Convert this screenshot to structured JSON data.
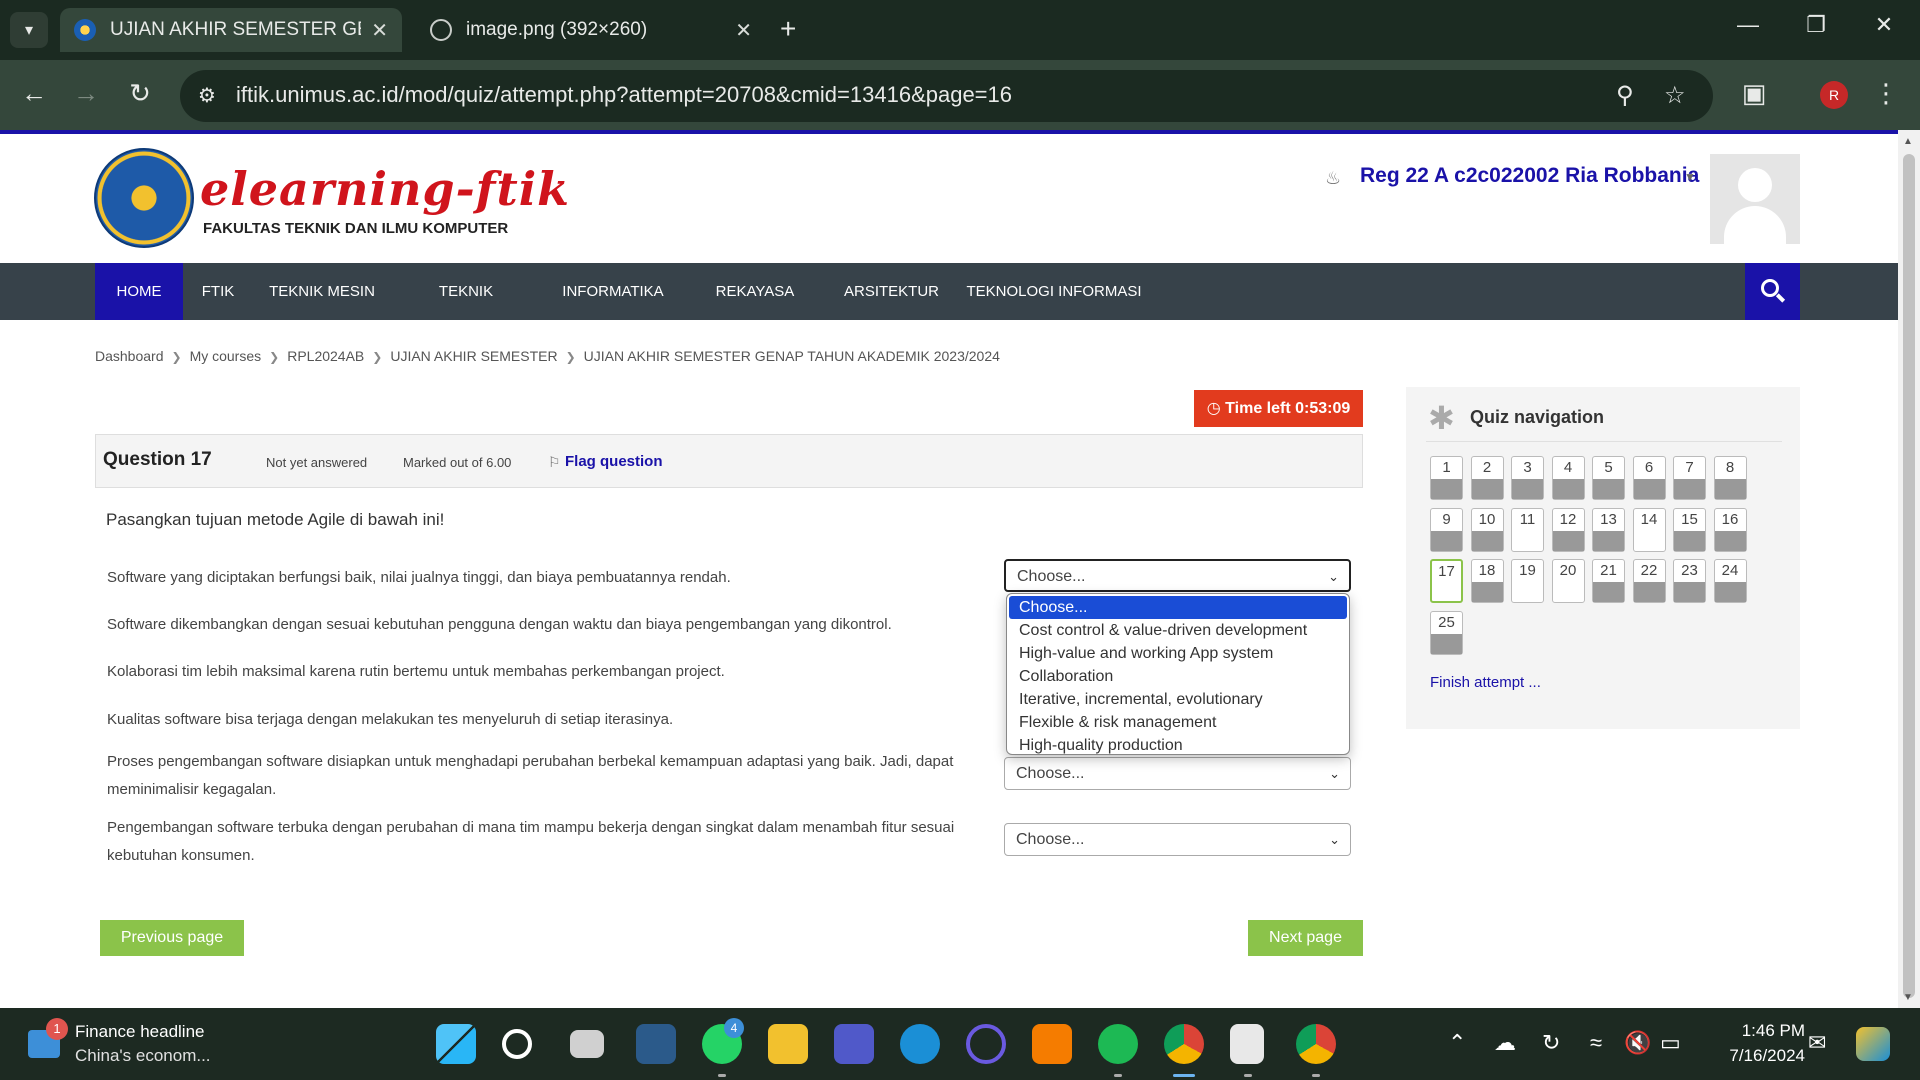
{
  "browser": {
    "tabs": [
      {
        "title": "UJIAN AKHIR SEMESTER GENAP",
        "active": true
      },
      {
        "title": "image.png (392×260)",
        "active": false
      }
    ],
    "url": "iftik.unimus.ac.id/mod/quiz/attempt.php?attempt=20708&cmid=13416&page=16",
    "profile_initial": "R"
  },
  "site": {
    "logo_title": "elearning-ftik",
    "logo_subtitle": "FAKULTAS TEKNIK DAN ILMU KOMPUTER",
    "user_name": "Reg 22 A c2c022002 Ria Robbania"
  },
  "nav": {
    "items": [
      "HOME",
      "FTIK",
      "TEKNIK MESIN",
      "TEKNIK ELEKTRO",
      "INFORMATIKA",
      "REKAYASA SIPIL",
      "ARSITEKTUR",
      "TEKNOLOGI INFORMASI"
    ],
    "active": "HOME"
  },
  "breadcrumb": [
    "Dashboard",
    "My courses",
    "RPL2024AB",
    "UJIAN AKHIR SEMESTER",
    "UJIAN AKHIR SEMESTER GENAP TAHUN AKADEMIK 2023/2024"
  ],
  "timer": "Time left 0:53:09",
  "question": {
    "number_label": "Question 17",
    "state": "Not yet answered",
    "grade": "Marked out of 6.00",
    "flag_label": "Flag question",
    "text": "Pasangkan tujuan metode Agile di bawah ini!",
    "rows": [
      {
        "text": "Software yang diciptakan berfungsi baik, nilai jualnya tinggi, dan biaya pembuatannya rendah.",
        "value": "Choose..."
      },
      {
        "text": "Software dikembangkan dengan sesuai kebutuhan pengguna dengan waktu dan biaya pengembangan yang dikontrol.",
        "value": "Choose..."
      },
      {
        "text": "Kolaborasi tim lebih maksimal karena rutin bertemu untuk membahas perkembangan project.",
        "value": "Choose..."
      },
      {
        "text": "Kualitas software bisa terjaga dengan melakukan tes menyeluruh di setiap iterasinya.",
        "value": "Choose..."
      },
      {
        "text": "Proses pengembangan software disiapkan untuk menghadapi perubahan berbekal kemampuan adaptasi yang baik. Jadi, dapat meminimalisir kegagalan.",
        "value": "Choose..."
      },
      {
        "text": "Pengembangan software terbuka dengan perubahan di mana tim mampu bekerja dengan singkat dalam menambah fitur sesuai kebutuhan konsumen.",
        "value": "Choose..."
      }
    ],
    "dropdown_options": [
      "Choose...",
      "Cost control & value-driven development",
      "High-value and working App system",
      "Collaboration",
      "Iterative, incremental, evolutionary",
      "Flexible & risk management",
      "High-quality production"
    ],
    "dropdown_selected": "Choose..."
  },
  "buttons": {
    "previous": "Previous page",
    "next": "Next page"
  },
  "quiz_nav": {
    "title": "Quiz navigation",
    "questions": [
      {
        "n": "1",
        "answered": true
      },
      {
        "n": "2",
        "answered": true
      },
      {
        "n": "3",
        "answered": true
      },
      {
        "n": "4",
        "answered": true
      },
      {
        "n": "5",
        "answered": true
      },
      {
        "n": "6",
        "answered": true
      },
      {
        "n": "7",
        "answered": true
      },
      {
        "n": "8",
        "answered": true
      },
      {
        "n": "9",
        "answered": true
      },
      {
        "n": "10",
        "answered": true
      },
      {
        "n": "11",
        "answered": false
      },
      {
        "n": "12",
        "answered": true
      },
      {
        "n": "13",
        "answered": true
      },
      {
        "n": "14",
        "answered": false
      },
      {
        "n": "15",
        "answered": true
      },
      {
        "n": "16",
        "answered": true
      },
      {
        "n": "17",
        "answered": false,
        "current": true
      },
      {
        "n": "18",
        "answered": true
      },
      {
        "n": "19",
        "answered": false
      },
      {
        "n": "20",
        "answered": false
      },
      {
        "n": "21",
        "answered": true
      },
      {
        "n": "22",
        "answered": true
      },
      {
        "n": "23",
        "answered": true
      },
      {
        "n": "24",
        "answered": true
      },
      {
        "n": "25",
        "answered": true
      }
    ],
    "finish_label": "Finish attempt ..."
  },
  "taskbar": {
    "news_badge": "1",
    "news_title": "Finance headline",
    "news_sub": "China's econom...",
    "whatsapp_badge": "4",
    "time": "1:46 PM",
    "date": "7/16/2024"
  },
  "colors": {
    "accent": "#1a12a8",
    "button_green": "#8bc34a",
    "timer_red": "#e23b1e",
    "nav_dark": "#37424a"
  }
}
